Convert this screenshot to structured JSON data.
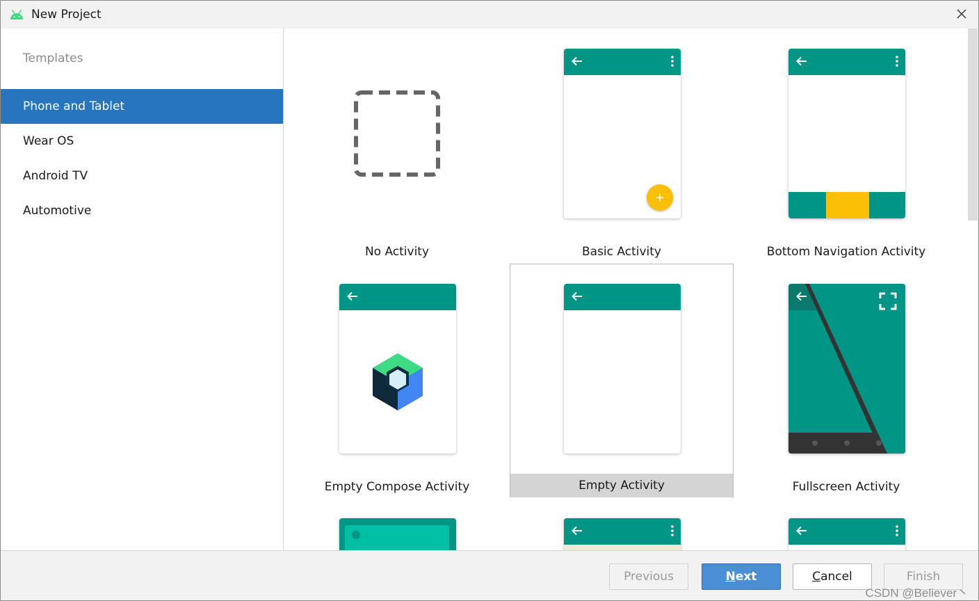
{
  "window": {
    "title": "New Project"
  },
  "sidebar": {
    "heading": "Templates",
    "items": [
      {
        "label": "Phone and Tablet",
        "selected": true
      },
      {
        "label": "Wear OS"
      },
      {
        "label": "Android TV"
      },
      {
        "label": "Automotive"
      }
    ]
  },
  "templates": [
    {
      "label": "No Activity"
    },
    {
      "label": "Basic Activity"
    },
    {
      "label": "Bottom Navigation Activity"
    },
    {
      "label": "Empty Compose Activity"
    },
    {
      "label": "Empty Activity",
      "selected": true
    },
    {
      "label": "Fullscreen Activity"
    }
  ],
  "footer": {
    "previous": "Previous",
    "next_mnemonic": "N",
    "next_rest": "ext",
    "cancel_mnemonic": "C",
    "cancel_rest": "ancel",
    "finish": "Finish",
    "watermark": "CSDN @Believer丶"
  },
  "colors": {
    "accent": "#2675bf",
    "teal": "#009585",
    "amber": "#fbbf05",
    "primary_button": "#4a8fd6"
  },
  "icons": [
    "android-icon",
    "close-icon",
    "back-arrow-icon",
    "more-vert-icon",
    "add-icon",
    "fullscreen-icon",
    "compose-logo-icon"
  ]
}
